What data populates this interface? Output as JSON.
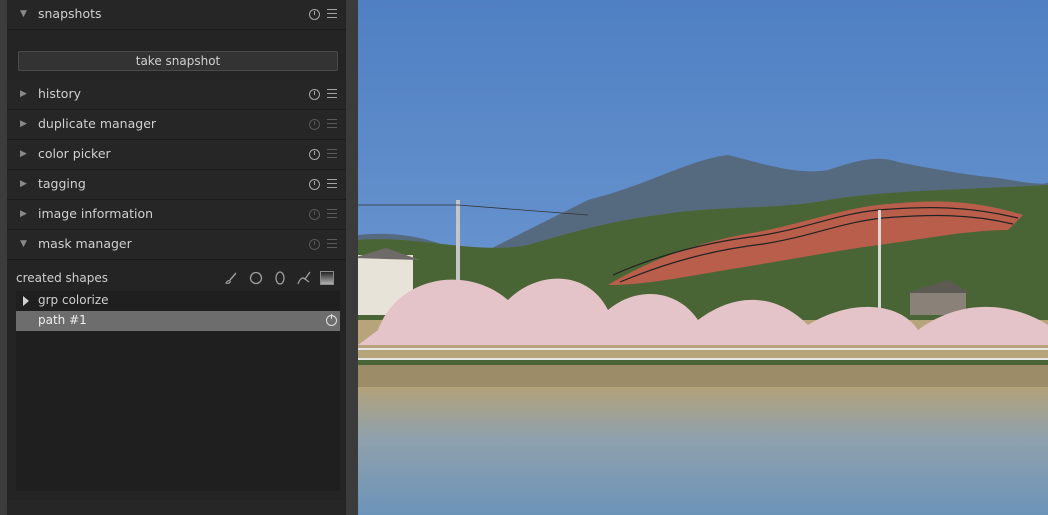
{
  "sidebar": {
    "modules": [
      {
        "title": "snapshots",
        "expanded": true,
        "reset_active": true
      },
      {
        "title": "history",
        "expanded": false,
        "reset_active": true
      },
      {
        "title": "duplicate manager",
        "expanded": false,
        "reset_active": false
      },
      {
        "title": "color picker",
        "expanded": false,
        "reset_active": true
      },
      {
        "title": "tagging",
        "expanded": false,
        "reset_active": true
      },
      {
        "title": "image information",
        "expanded": false,
        "reset_active": false
      },
      {
        "title": "mask manager",
        "expanded": true,
        "reset_active": false
      }
    ],
    "snapshots": {
      "take_snapshot_label": "take snapshot"
    },
    "mask_manager": {
      "created_shapes_label": "created shapes",
      "shape_tools": [
        "brush-icon",
        "circle-icon",
        "ellipse-icon",
        "path-icon",
        "gradient-icon"
      ],
      "tree": [
        {
          "label": "grp colorize",
          "type": "group",
          "selected": false
        },
        {
          "label": "path #1",
          "type": "shape",
          "selected": true
        }
      ]
    }
  },
  "icons": {
    "expanded": "▼",
    "collapsed": "▶"
  },
  "colors": {
    "panel_bg": "#262626",
    "selected_row": "#6d6d6d",
    "mask_overlay": "#ff5a5a",
    "sky": "#5d8cc8"
  }
}
